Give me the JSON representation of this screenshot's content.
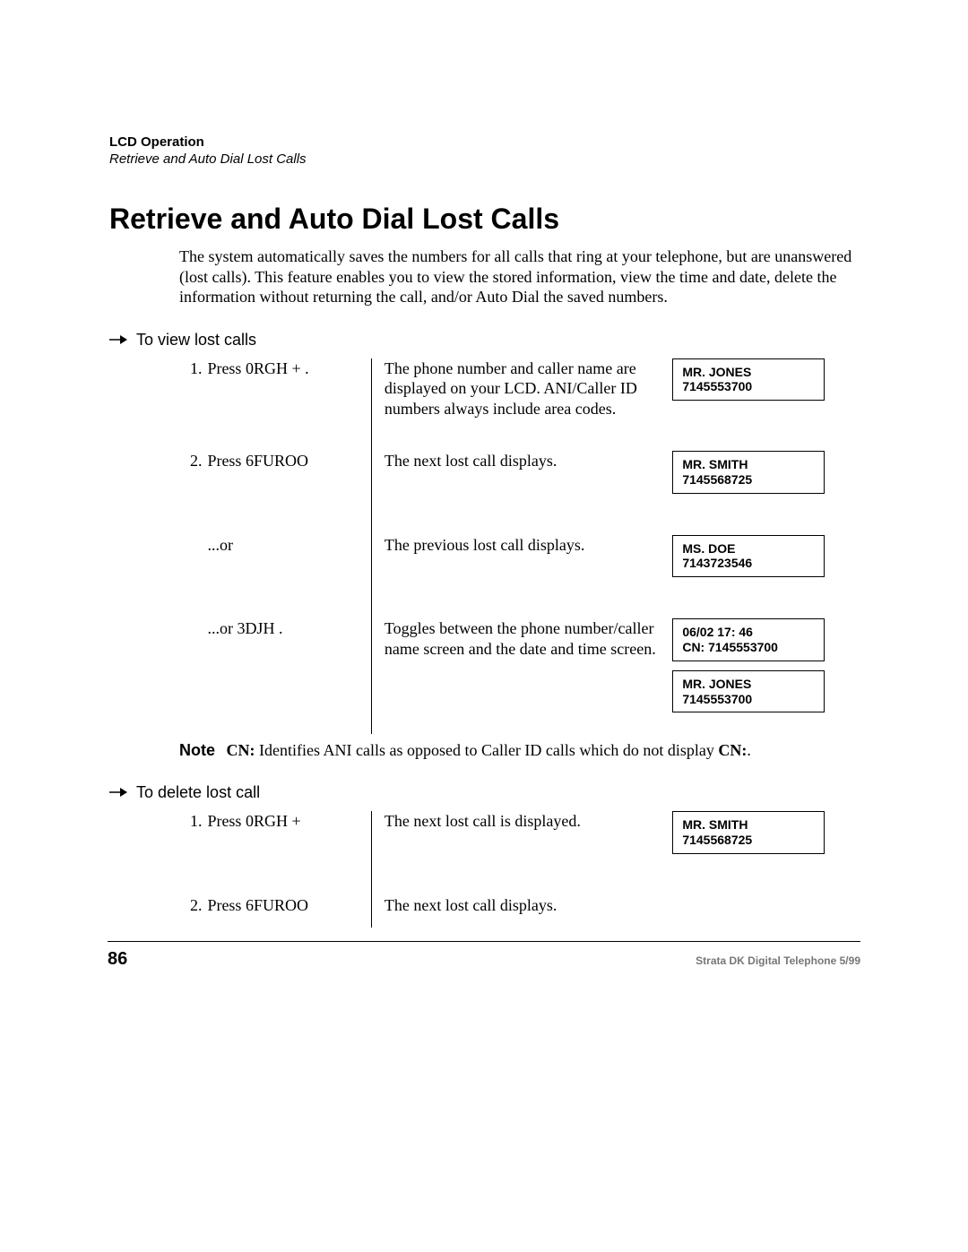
{
  "header": {
    "chapter": "LCD Operation",
    "section": "Retrieve and Auto Dial Lost Calls"
  },
  "title": "Retrieve and Auto Dial Lost Calls",
  "intro": "The system automatically saves the numbers for all calls that ring at your telephone, but are unanswered (lost calls). This feature enables you to view the stored information, view the time and date, delete the information without returning the call, and/or Auto Dial the saved numbers.",
  "sections": {
    "view": {
      "heading": "To view lost calls",
      "rows": [
        {
          "num": "1.",
          "step_prefix": "Press ",
          "step_key": "0RGH",
          "step_suffix": " +      .",
          "desc": "The phone number and caller name are displayed on your LCD. ANI/Caller ID numbers always include area codes.",
          "lcd": [
            {
              "l1": "MR. JONES",
              "l2": "7145553700"
            }
          ]
        },
        {
          "num": "2.",
          "step_prefix": "Press ",
          "step_key": "6FUROO",
          "step_suffix": "",
          "desc": "The next lost call displays.",
          "lcd": [
            {
              "l1": "MR. SMITH",
              "l2": "7145568725"
            }
          ]
        },
        {
          "num": "",
          "step_prefix": "...or",
          "step_key": "",
          "step_suffix": "",
          "desc": "The previous lost call displays.",
          "lcd": [
            {
              "l1": "MS. DOE",
              "l2": "7143723546"
            }
          ]
        },
        {
          "num": "",
          "step_prefix": "...or ",
          "step_key": "3DJH",
          "step_suffix": " .",
          "desc": "Toggles between the phone number/caller name screen and the date and time screen.",
          "lcd": [
            {
              "l1": "06/02  17: 46",
              "l2": "CN: 7145553700"
            },
            {
              "l1": "MR. JONES",
              "l2": "7145553700"
            }
          ]
        }
      ]
    },
    "delete": {
      "heading": "To delete lost call",
      "rows": [
        {
          "num": "1.",
          "step_prefix": "Press ",
          "step_key": "0RGH",
          "step_suffix": " +",
          "desc": "The next lost call is displayed.",
          "lcd": [
            {
              "l1": "MR. SMITH",
              "l2": "7145568725"
            }
          ]
        },
        {
          "num": "2.",
          "step_prefix": "Press ",
          "step_key": "6FUROO",
          "step_suffix": "",
          "desc": "The next lost call displays.",
          "lcd": []
        }
      ]
    }
  },
  "note": {
    "label": "Note",
    "body_pre": "CN:",
    "body_mid": " Identifies ANI calls as opposed to Caller ID calls which do not display ",
    "body_post": "CN:",
    "body_end": "."
  },
  "footer": {
    "page": "86",
    "right": "Strata DK Digital Telephone   5/99"
  }
}
